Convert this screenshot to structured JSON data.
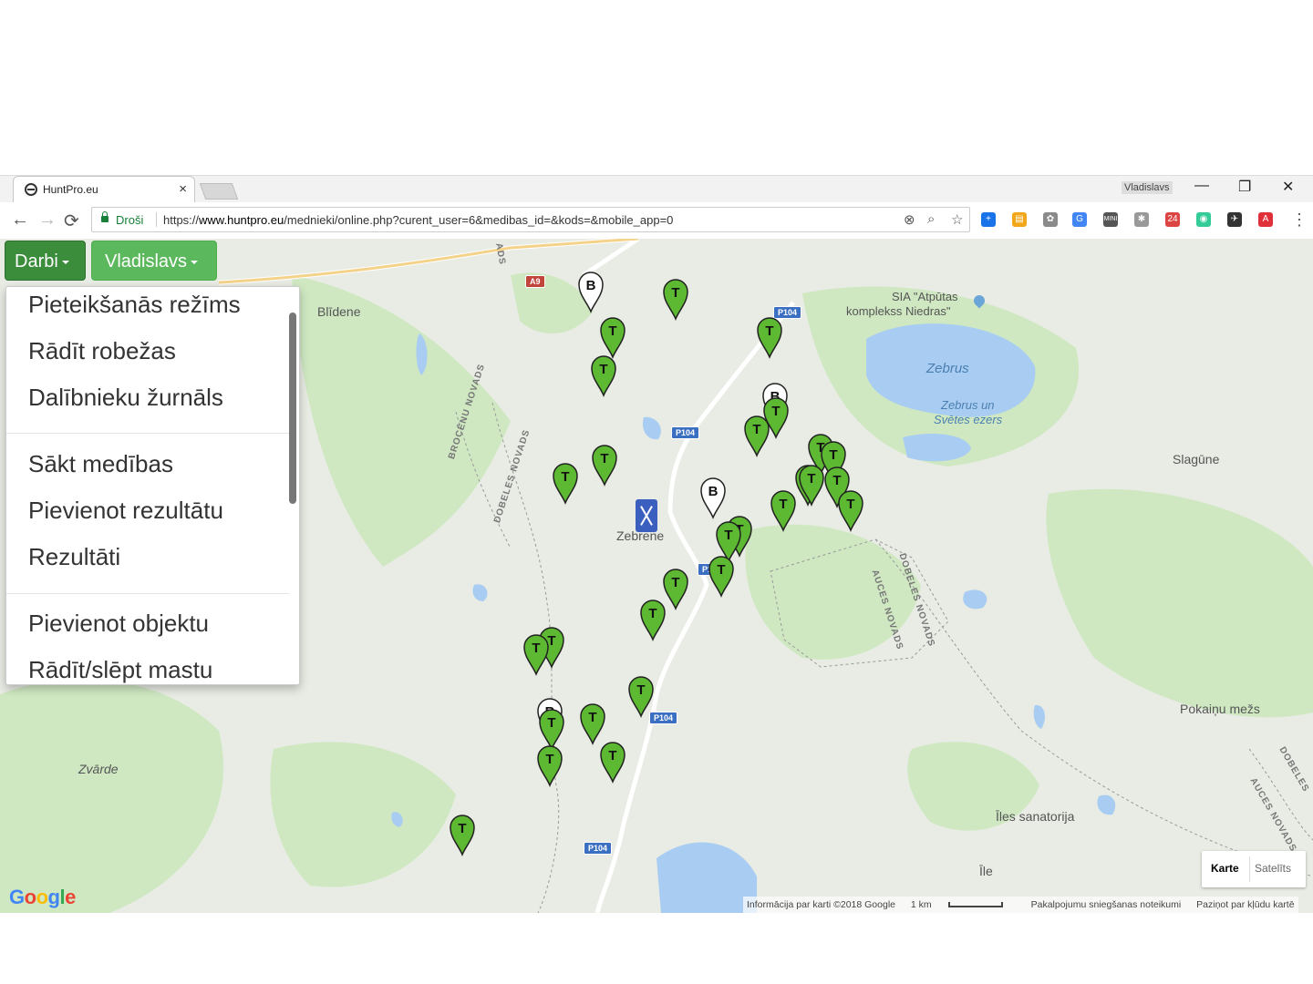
{
  "browser": {
    "tab_title": "HuntPro.eu",
    "tab_close": "×",
    "profile_name": "Vladislavs",
    "window_controls": {
      "minimize": "—",
      "restore": "❐",
      "close": "✕"
    },
    "nav": {
      "back": "←",
      "forward": "→",
      "reload": "⟳"
    },
    "secure_label": "Droši",
    "url_prefix": "https://",
    "url_host": "www.huntpro.eu",
    "url_path": "/mednieki/online.php?curent_user=6&medibas_id=&kods=&mobile_app=0",
    "menu": "⋮",
    "extensions": [
      {
        "icon": "blue-plus-icon",
        "color": "#1a73e8",
        "glyph": "+"
      },
      {
        "icon": "orange-box-icon",
        "color": "#f2a71b",
        "glyph": "▤"
      },
      {
        "icon": "brain-icon",
        "color": "#8a8a8a",
        "glyph": "✿"
      },
      {
        "icon": "translate-icon",
        "color": "#4285f4",
        "glyph": "G"
      },
      {
        "icon": "mini-icon",
        "color": "#555555",
        "glyph": "MINI"
      },
      {
        "icon": "spark-icon",
        "color": "#999999",
        "glyph": "✱"
      },
      {
        "icon": "calendar-icon",
        "color": "#d44",
        "glyph": "24"
      },
      {
        "icon": "globe-icon",
        "color": "#3c9",
        "glyph": "◉"
      },
      {
        "icon": "telescope-icon",
        "color": "#333333",
        "glyph": "✈"
      },
      {
        "icon": "adblock-icon",
        "color": "#e0303a",
        "glyph": "A"
      }
    ]
  },
  "app": {
    "menu_button": "Darbi",
    "user_button": "Vladislavs",
    "dropdown": [
      [
        "Pieteikšanās režīms",
        "Rādīt robežas",
        "Dalībnieku žurnāls"
      ],
      [
        "Sākt medības",
        "Pievienot rezultātu",
        "Rezultāti"
      ],
      [
        "Pievienot objektu",
        "Rādīt/slēpt mastu"
      ]
    ]
  },
  "map": {
    "places": {
      "blidene": "Blīdene",
      "sia": "SIA \"Atpūtas",
      "sia2": "komplekss Niedras\"",
      "zebrus": "Zebrus",
      "zebrus_svetes": "Zebrus un",
      "zebrus_svetes2": "Svētes ezers",
      "slagune": "Slagūne",
      "zebrene": "Zebrene",
      "pokainu": "Pokaiņu mežs",
      "zvarde": "Zvārde",
      "iles_sanat": "Īles sanatorija",
      "ile": "Īle"
    },
    "admin": {
      "brocenu": "BROCĒNU NOVADS",
      "dobeles1": "DOBELES NOVADS",
      "dobeles2": "DOBELES NOVADS",
      "auces1": "AUCES NOVADS",
      "dobeles3": "DOBELES",
      "auces2": "AUCES NOVADS",
      "ads": "ADS"
    },
    "roads": {
      "a9": "A9",
      "p104": "P104"
    },
    "map_type": {
      "map": "Karte",
      "satellite": "Satelīts"
    },
    "google": "Google",
    "attribution": {
      "data": "Informācija par karti ©2018 Google",
      "scale": "1 km",
      "terms": "Pakalpojumu sniegšanas noteikumi",
      "report": "Paziņot par kļūdu kartē"
    },
    "colors": {
      "marker_green": "#5db832",
      "marker_white": "#ffffff",
      "water": "#a9cdf2",
      "land": "#e8ece4",
      "forest": "#cfe8c2"
    }
  }
}
